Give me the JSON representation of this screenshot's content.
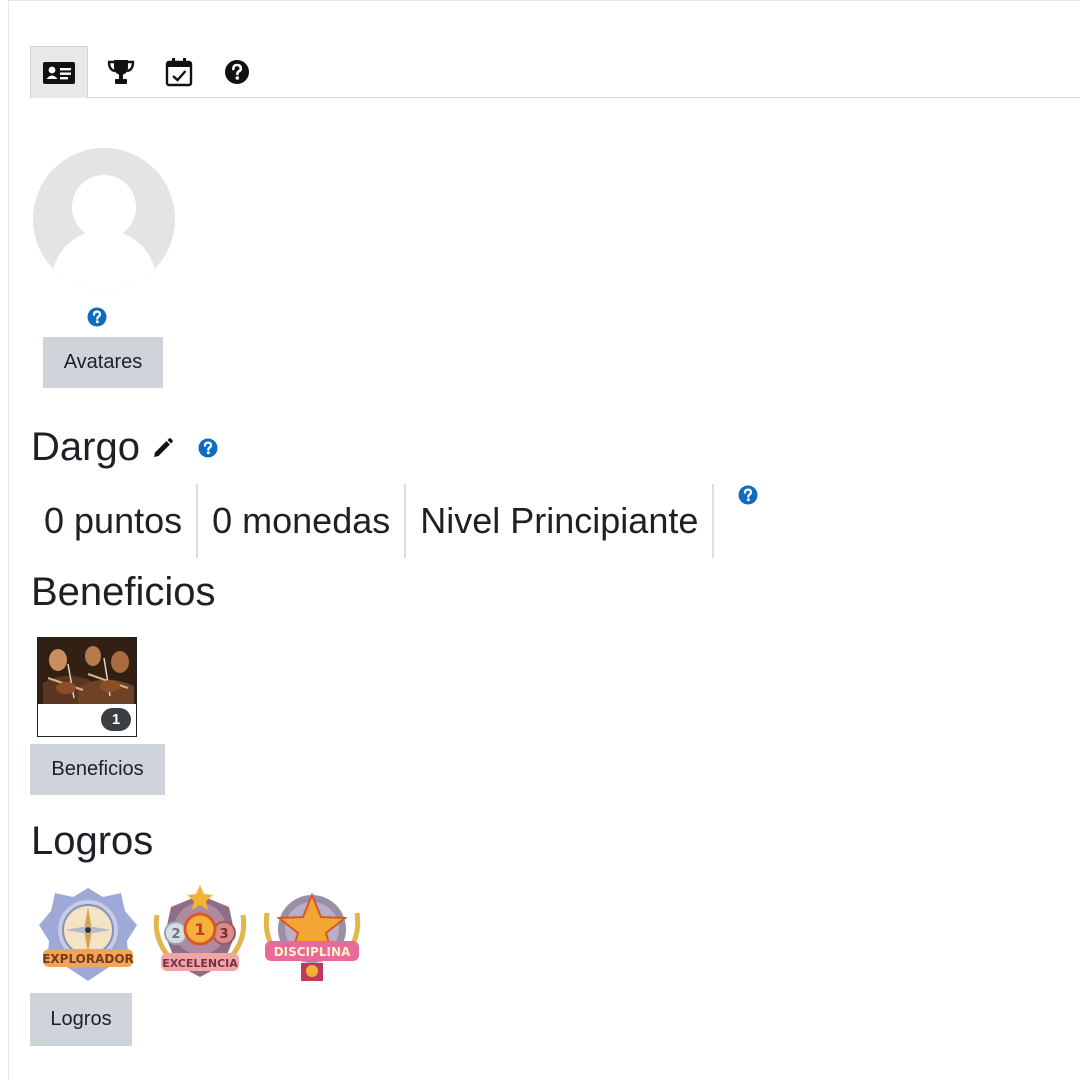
{
  "tabs": [
    {
      "icon": "id-card-icon",
      "active": true
    },
    {
      "icon": "trophy-icon",
      "active": false
    },
    {
      "icon": "calendar-check-icon",
      "active": false
    },
    {
      "icon": "question-circle-icon",
      "active": false
    }
  ],
  "avatar": {
    "button_label": "Avatares"
  },
  "profile": {
    "username": "Dargo",
    "stats": [
      "0 puntos",
      "0 monedas",
      "Nivel Principiante"
    ]
  },
  "benefits": {
    "title": "Beneficios",
    "items": [
      {
        "count": "1"
      }
    ],
    "button_label": "Beneficios"
  },
  "achievements": {
    "title": "Logros",
    "badges": [
      {
        "label": "EXPLORADOR"
      },
      {
        "label": "EXCELENCIA"
      },
      {
        "label": "DISCIPLINA"
      }
    ],
    "button_label": "Logros"
  },
  "colors": {
    "help_blue": "#0f6cbf",
    "button_bg": "#ced4da",
    "badge_dark": "#3b3f43"
  }
}
